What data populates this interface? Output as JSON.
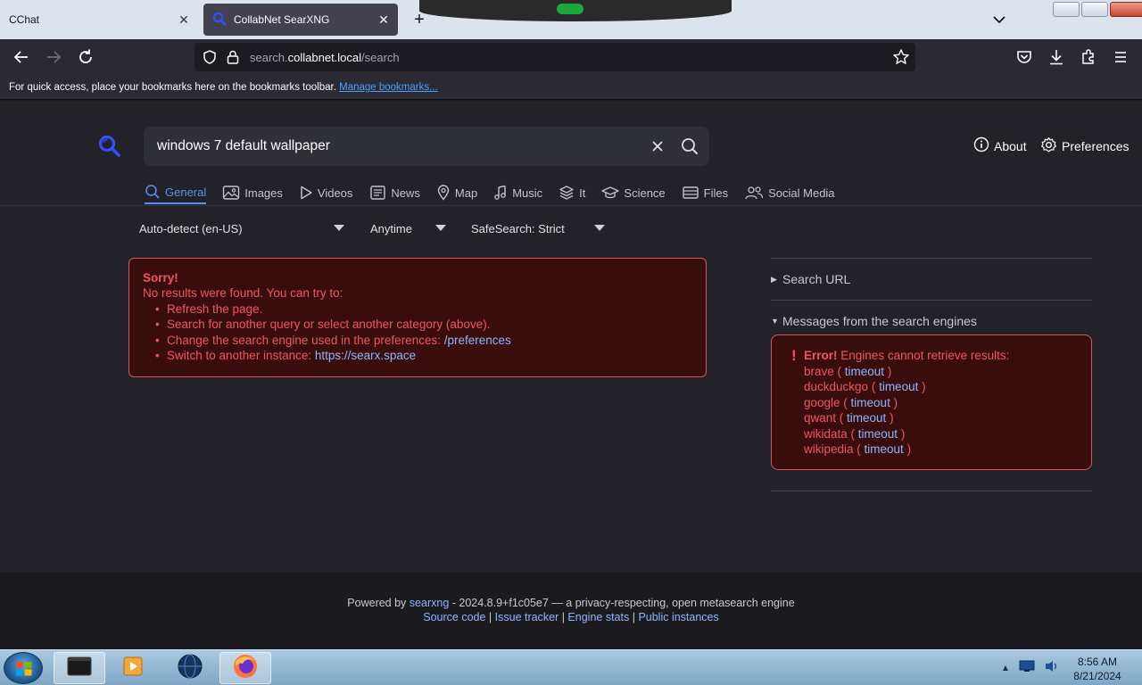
{
  "browser": {
    "tabs": [
      {
        "title": "CChat",
        "active": false
      },
      {
        "title": "CollabNet SearXNG",
        "active": true
      }
    ],
    "url_prefix": "search.",
    "url_domain": "collabnet.local",
    "url_path": "/search",
    "bookmarks_message": "For quick access, place your bookmarks here on the bookmarks toolbar.",
    "bookmarks_link": "Manage bookmarks..."
  },
  "search": {
    "query": "windows 7 default wallpaper",
    "about_label": "About",
    "preferences_label": "Preferences"
  },
  "categories": [
    {
      "label": "General",
      "icon": "search-icon",
      "active": true
    },
    {
      "label": "Images",
      "icon": "image-icon"
    },
    {
      "label": "Videos",
      "icon": "play-icon"
    },
    {
      "label": "News",
      "icon": "newspaper-icon"
    },
    {
      "label": "Map",
      "icon": "map-pin-icon"
    },
    {
      "label": "Music",
      "icon": "music-note-icon"
    },
    {
      "label": "It",
      "icon": "layers-icon"
    },
    {
      "label": "Science",
      "icon": "school-icon"
    },
    {
      "label": "Files",
      "icon": "file-tray-icon"
    },
    {
      "label": "Social Media",
      "icon": "people-icon"
    }
  ],
  "filters": {
    "language": "Auto-detect (en-US)",
    "time": "Anytime",
    "safesearch": "SafeSearch: Strict"
  },
  "no_results": {
    "heading": "Sorry!",
    "intro": "No results were found. You can try to:",
    "tip_refresh": "Refresh the page.",
    "tip_query": "Search for another query or select another category (above).",
    "tip_engine": "Change the search engine used in the preferences:",
    "tip_engine_link": "/preferences",
    "tip_instance": "Switch to another instance:",
    "tip_instance_link": "https://searx.space"
  },
  "sidebar": {
    "search_url_label": "Search URL",
    "messages_label": "Messages from the search engines",
    "error_title": "Error!",
    "error_text": "Engines cannot retrieve results:",
    "engines": [
      {
        "name": "brave",
        "status": "timeout"
      },
      {
        "name": "duckduckgo",
        "status": "timeout"
      },
      {
        "name": "google",
        "status": "timeout"
      },
      {
        "name": "qwant",
        "status": "timeout"
      },
      {
        "name": "wikidata",
        "status": "timeout"
      },
      {
        "name": "wikipedia",
        "status": "timeout"
      }
    ]
  },
  "footer": {
    "powered_by": "Powered by",
    "searxng_link": "searxng",
    "version_text": "- 2024.8.9+f1c05e7 — a privacy-respecting, open metasearch engine",
    "source_code": "Source code",
    "issue_tracker": "Issue tracker",
    "engine_stats": "Engine stats",
    "public_instances": "Public instances",
    "separator": "|"
  },
  "taskbar": {
    "time": "8:56 AM",
    "date": "8/21/2024"
  },
  "colors": {
    "accent": "#5b8ef6",
    "error": "#f0565f",
    "link": "#8fb5ff"
  }
}
